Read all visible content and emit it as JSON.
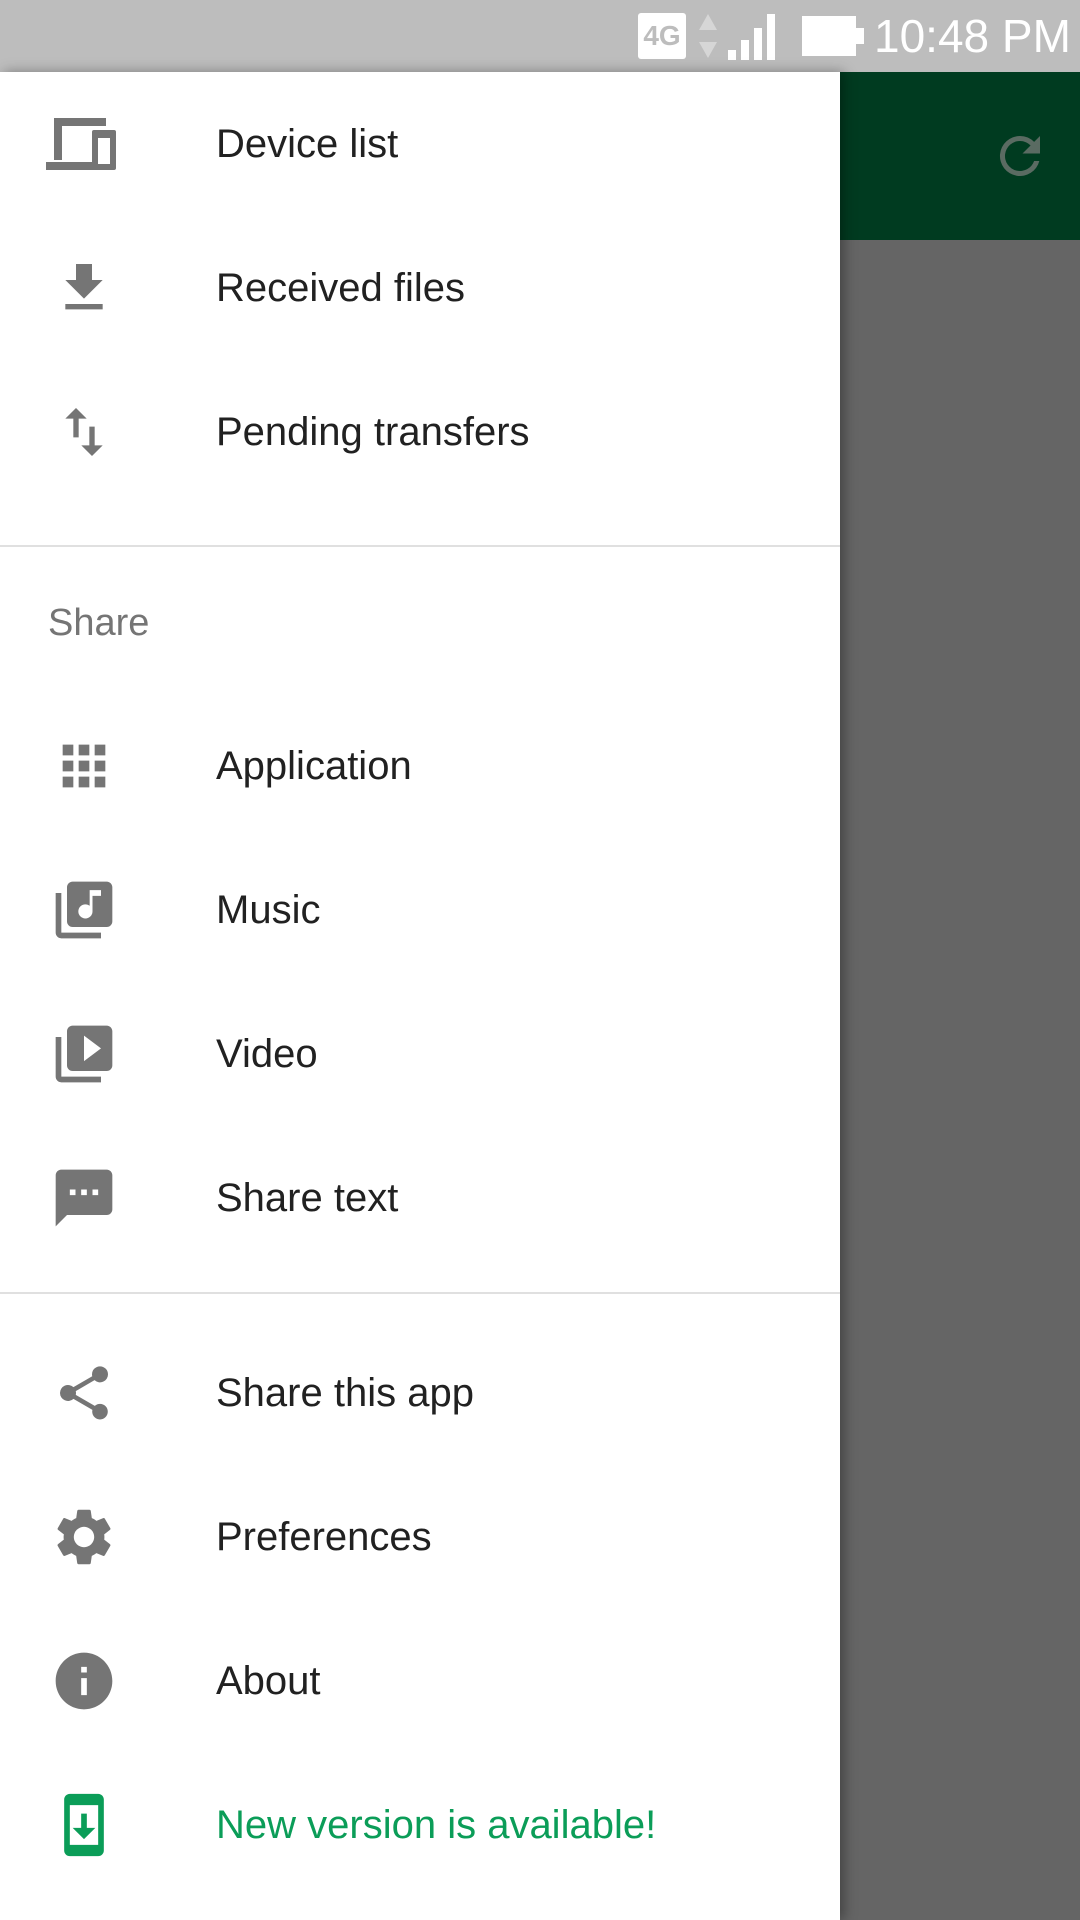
{
  "status_bar": {
    "network": "4G",
    "time": "10:48 PM"
  },
  "drawer": {
    "primary_items": [
      {
        "label": "Device list",
        "icon": "devices-icon"
      },
      {
        "label": "Received files",
        "icon": "download-icon"
      },
      {
        "label": "Pending transfers",
        "icon": "swap-vert-icon"
      }
    ],
    "share_header": "Share",
    "share_items": [
      {
        "label": "Application",
        "icon": "apps-grid-icon"
      },
      {
        "label": "Music",
        "icon": "music-library-icon"
      },
      {
        "label": "Video",
        "icon": "video-library-icon"
      },
      {
        "label": "Share text",
        "icon": "message-icon"
      }
    ],
    "secondary_items": [
      {
        "label": "Share this app",
        "icon": "share-icon"
      },
      {
        "label": "Preferences",
        "icon": "gear-icon"
      },
      {
        "label": "About",
        "icon": "info-icon"
      },
      {
        "label": "New version is available!",
        "icon": "system-update-icon"
      }
    ]
  },
  "colors": {
    "status_bar": "#bdbdbd",
    "toolbar": "#003b20",
    "scrim": "#656565",
    "accent_green": "#0b9d58",
    "icon_grey": "#757575",
    "text_primary": "#212121"
  }
}
